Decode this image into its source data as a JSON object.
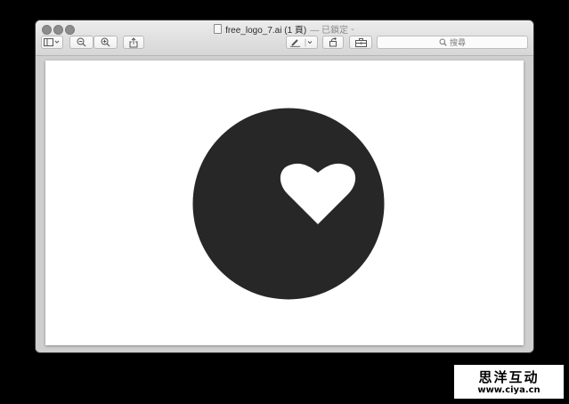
{
  "window": {
    "title": "free_logo_7.ai (1 頁)",
    "status": "— 已鎖定",
    "status_chevron": "⌄"
  },
  "toolbar": {
    "search_placeholder": "搜尋",
    "icons": [
      "sidebar-icon",
      "chevron-down-icon",
      "zoom-out-icon",
      "zoom-in-icon",
      "share-icon",
      "markup-pen-icon",
      "rotate-icon",
      "toolbox-icon",
      "search-icon"
    ]
  },
  "document": {
    "logo": {
      "description_icon": "heart-in-circle-logo",
      "circle_color": "#272727",
      "heart_color": "#ffffff"
    }
  },
  "watermark": {
    "chinese": "思洋互动",
    "url": "www.ciya.cn"
  },
  "colors": {
    "background": "#000000",
    "window": "#d3d3d3",
    "page": "#ffffff"
  }
}
